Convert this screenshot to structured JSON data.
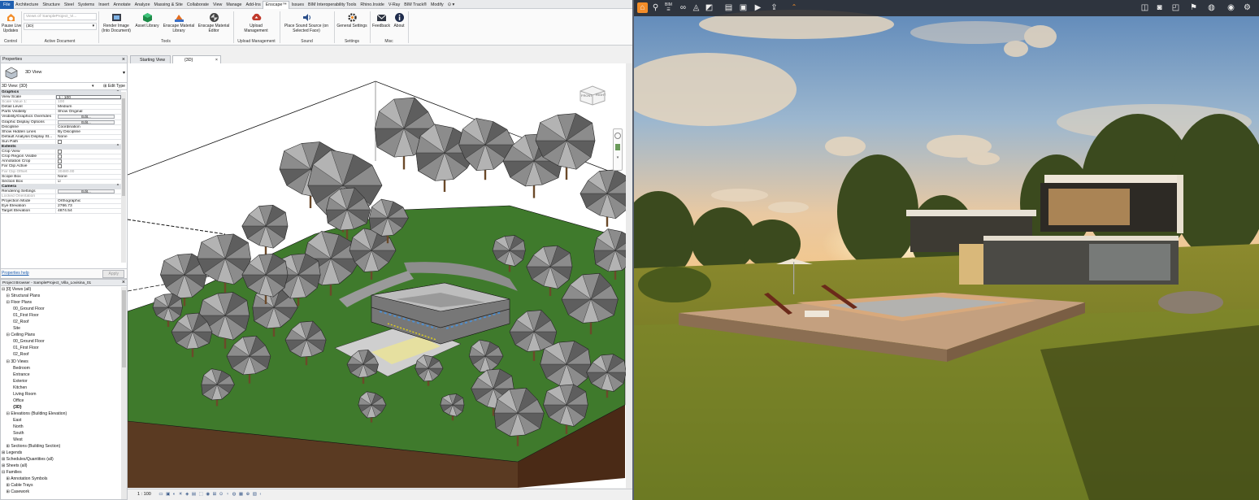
{
  "revit": {
    "tabs": [
      "File",
      "Architecture",
      "Structure",
      "Steel",
      "Systems",
      "Insert",
      "Annotate",
      "Analyze",
      "Massing & Site",
      "Collaborate",
      "View",
      "Manage",
      "Add-Ins",
      "Enscape™",
      "Issues",
      "BIM Interoperability Tools",
      "Rhino.Inside",
      "V-Ray",
      "BIM Track®",
      "Modify",
      "⊙ ▾"
    ],
    "active_tab": "Enscape™",
    "ribbon": {
      "pause_live_updates": "Pause Live\nUpdates",
      "views_combo_placeholder": "Views of 'SampleProject_Vi...",
      "views_select_value": "(3D)",
      "render_image": "Render Image\n(Into Document)",
      "asset_library": "Asset Library",
      "enscape_material_library": "Enscape Material\nLibrary",
      "enscape_material_editor": "Enscape Material\nEditor",
      "upload_management": "Upload\nManagement",
      "place_sound_source": "Place Sound Source (on\nSelected Face)",
      "general_settings": "General Settings",
      "feedback": "Feedback",
      "about": "About",
      "groups": [
        "Control",
        "Active Document",
        "Tools",
        "Upload Management",
        "Sound",
        "Settings",
        "Misc"
      ]
    },
    "properties": {
      "title": "Properties",
      "type_name": "3D View",
      "selector_value": "3D View: {3D}",
      "edit_type": "Edit Type",
      "help_link": "Properties help",
      "apply": "Apply",
      "rows": [
        {
          "k": "Graphics",
          "v": "",
          "grp": true
        },
        {
          "k": "View Scale",
          "v": "1 : 100",
          "input": true
        },
        {
          "k": "Scale Value    1:",
          "v": "100",
          "dim": true
        },
        {
          "k": "Detail Level",
          "v": "Medium"
        },
        {
          "k": "Parts Visibility",
          "v": "Show Original"
        },
        {
          "k": "Visibility/Graphics Overrides",
          "v": "Edit...",
          "btn": true
        },
        {
          "k": "Graphic Display Options",
          "v": "Edit...",
          "btn": true
        },
        {
          "k": "Discipline",
          "v": "Coordination"
        },
        {
          "k": "Show Hidden Lines",
          "v": "By Discipline"
        },
        {
          "k": "Default Analysis Display St...",
          "v": "None"
        },
        {
          "k": "Sun Path",
          "v": "",
          "chk": true
        },
        {
          "k": "Extents",
          "v": "",
          "grp": true
        },
        {
          "k": "Crop View",
          "v": "",
          "chk": true
        },
        {
          "k": "Crop Region Visible",
          "v": "",
          "chk": true
        },
        {
          "k": "Annotation Crop",
          "v": "",
          "chk": true
        },
        {
          "k": "Far Clip Active",
          "v": "",
          "chk": true
        },
        {
          "k": "Far Clip Offset",
          "v": "30480.00",
          "dim": true
        },
        {
          "k": "Scope Box",
          "v": "None"
        },
        {
          "k": "Section Box",
          "v": "☑",
          "chk": true
        },
        {
          "k": "Camera",
          "v": "",
          "grp": true
        },
        {
          "k": "Rendering Settings",
          "v": "Edit...",
          "btn": true
        },
        {
          "k": "Locked Orientation",
          "v": "",
          "dim": true
        },
        {
          "k": "Projection Mode",
          "v": "Orthographic"
        },
        {
          "k": "Eye Elevation",
          "v": "2766.73"
        },
        {
          "k": "Target Elevation",
          "v": "4874.54"
        }
      ]
    },
    "browser": {
      "title": "Project Browser - SampleProject_Villa_Lovisina_01",
      "items": [
        "⊟ [0] Views (all)",
        "    ⊟ Structural Plans",
        "    ⊟ Floor Plans",
        "          00_Ground Floor",
        "          01_First Floor",
        "          02_Roof",
        "          Site",
        "    ⊟ Ceiling Plans",
        "          00_Ground Floor",
        "          01_First Floor",
        "          02_Roof",
        "    ⊟ 3D Views",
        "          Bedroom",
        "          Entrance",
        "          Exterior",
        "          Kitchen",
        "          Living Room",
        "          Office",
        "          {3D}",
        "    ⊟ Elevations (Building Elevation)",
        "          East",
        "          North",
        "          South",
        "          West",
        "    ⊞ Sections (Building Section)",
        "⊞ Legends",
        "⊞ Schedules/Quantities (all)",
        "⊞ Sheets (all)",
        "⊟ Families",
        "    ⊞ Annotation Symbols",
        "    ⊞ Cable Trays",
        "    ⊞ Casework"
      ]
    },
    "view_tabs": [
      "Starting View",
      "{3D}"
    ],
    "view_cube": {
      "front": "FRONT",
      "right": "RIGHT"
    },
    "status_scale": "1 : 100"
  },
  "enscape": {
    "toolbar_left": [
      "home-icon",
      "walk-icon",
      "bim-icon",
      "binoculars-icon",
      "perspective-icon",
      "screenshot-icon",
      "batch-render-icon",
      "panorama-icon",
      "video-icon",
      "export-icon"
    ],
    "toolbar_right": [
      "views-icon",
      "camera-icon",
      "vr-icon",
      "collaboration-icon",
      "assets-icon",
      "visibility-icon",
      "settings-icon"
    ],
    "bim_label": "BIM",
    "colors": {
      "accent": "#f28c28",
      "toolbar": "#26262a"
    }
  }
}
